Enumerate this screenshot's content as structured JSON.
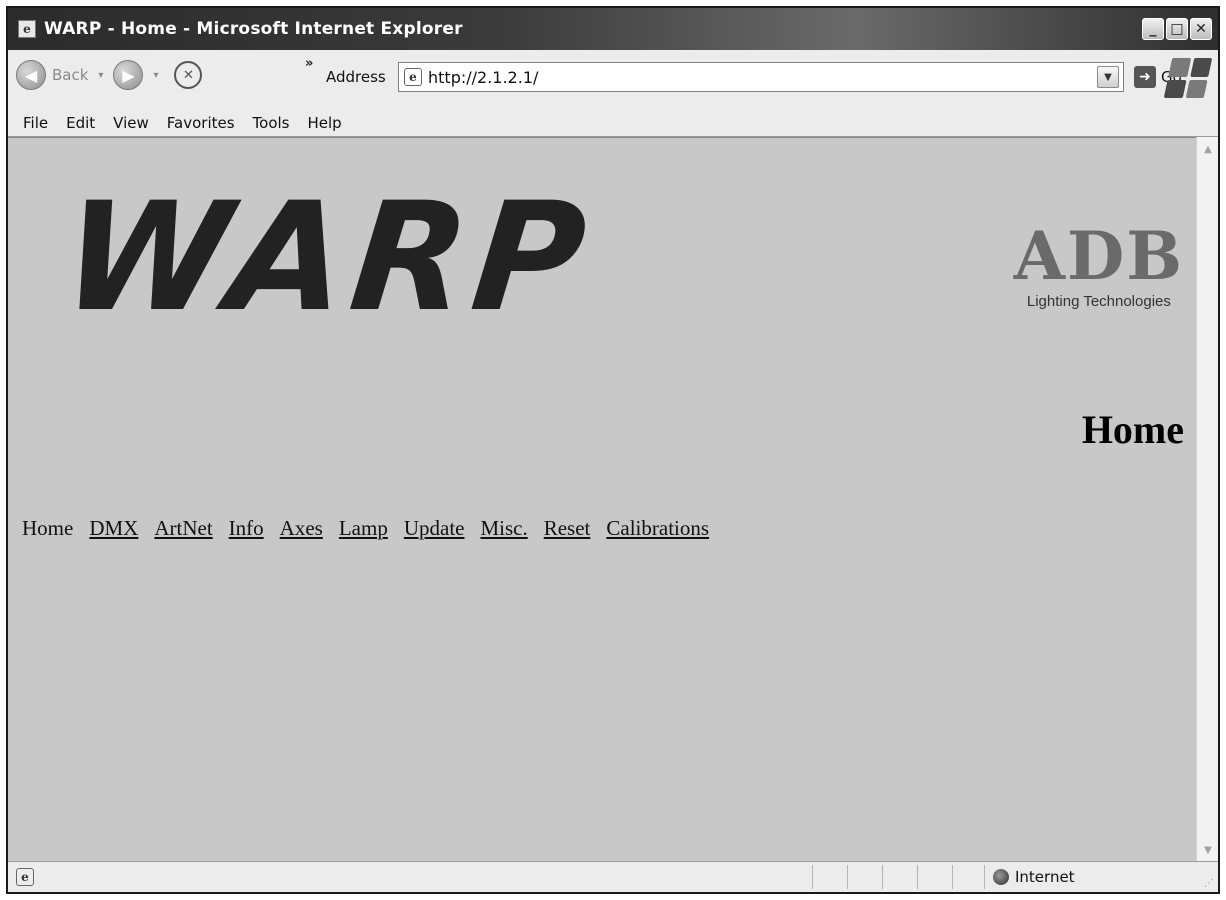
{
  "window": {
    "title": "WARP - Home - Microsoft Internet Explorer",
    "minimize": "_",
    "maximize": "□",
    "close": "✕"
  },
  "toolbar": {
    "back_label": "Back",
    "chevrons": "»",
    "address_label": "Address",
    "address_value": "http://2.1.2.1/",
    "go_label": "Go"
  },
  "menu": [
    "File",
    "Edit",
    "View",
    "Favorites",
    "Tools",
    "Help"
  ],
  "page": {
    "warp_logo": "WARP",
    "adb_logo": "ADB",
    "adb_tagline": "Lighting Technologies",
    "heading": "Home",
    "nav": [
      {
        "label": "Home",
        "link": false
      },
      {
        "label": "DMX",
        "link": true
      },
      {
        "label": "ArtNet",
        "link": true
      },
      {
        "label": "Info",
        "link": true
      },
      {
        "label": "Axes",
        "link": true
      },
      {
        "label": "Lamp",
        "link": true
      },
      {
        "label": "Update",
        "link": true
      },
      {
        "label": "Misc.",
        "link": true
      },
      {
        "label": "Reset",
        "link": true
      },
      {
        "label": "Calibrations",
        "link": true
      }
    ]
  },
  "status": {
    "zone": "Internet"
  }
}
